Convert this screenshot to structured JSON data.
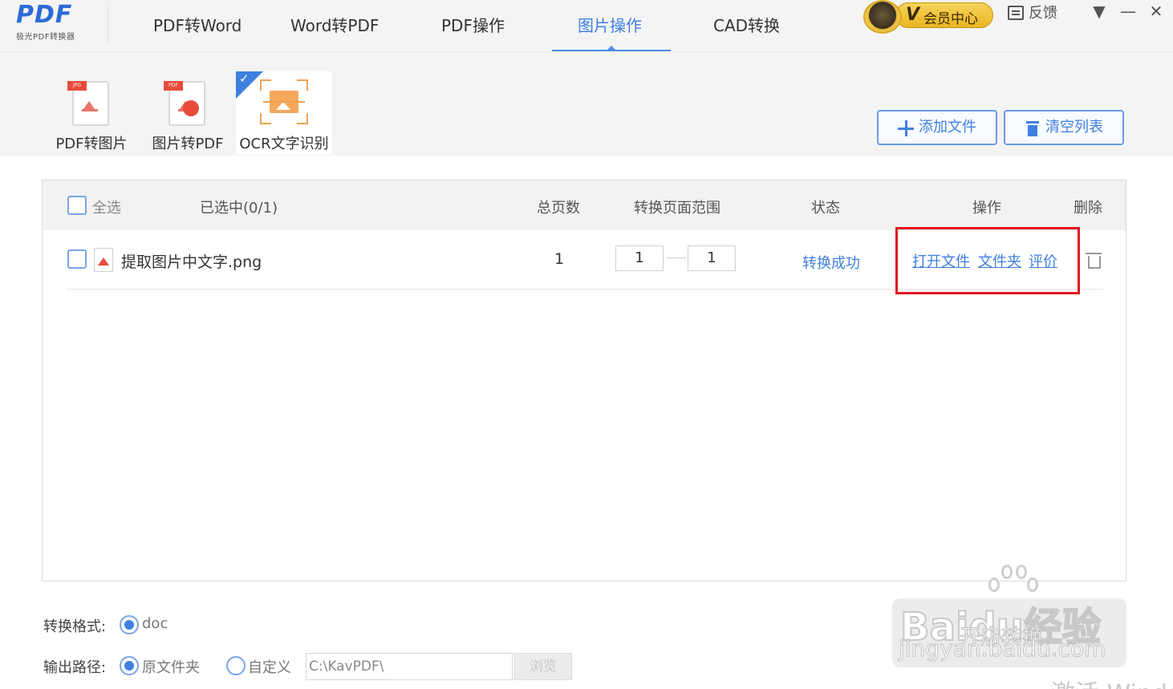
{
  "app": {
    "logo_text": "PDF",
    "logo_subtitle": "极光PDF转换器"
  },
  "nav": {
    "tabs": [
      {
        "label": "PDF转Word"
      },
      {
        "label": "Word转PDF"
      },
      {
        "label": "PDF操作"
      },
      {
        "label": "图片操作",
        "active": true
      },
      {
        "label": "CAD转换"
      }
    ]
  },
  "header": {
    "vip_v": "V",
    "vip_label": "会员中心",
    "feedback_label": "反馈",
    "menu_glyph": "▼",
    "minimize_glyph": "—",
    "close_glyph": "✕"
  },
  "tools": [
    {
      "label": "PDF转图片",
      "icon": "pdf-to-image-icon",
      "tag": "JPG"
    },
    {
      "label": "图片转PDF",
      "icon": "image-to-pdf-icon",
      "tag": "PDF"
    },
    {
      "label": "OCR文字识别",
      "icon": "ocr-scan-icon",
      "selected": true
    }
  ],
  "actions": {
    "add_file": "添加文件",
    "clear_list": "清空列表"
  },
  "table": {
    "select_all": "全选",
    "selected_count": "已选中(0/1)",
    "columns": {
      "pages": "总页数",
      "range": "转换页面范围",
      "status": "状态",
      "operation": "操作",
      "delete": "删除"
    },
    "rows": [
      {
        "file_name": "提取图片中文字.png",
        "pages": "1",
        "range_from": "1",
        "range_to": "1",
        "status": "转换成功",
        "actions": [
          "打开文件",
          "文件夹",
          "评价"
        ]
      }
    ]
  },
  "options": {
    "format_label": "转换格式:",
    "format_value": "doc",
    "output_label": "输出路径:",
    "output_original": "原文件夹",
    "output_custom": "自定义",
    "output_path": "C:\\KavPDF\\",
    "browse": "浏览"
  },
  "watermark": {
    "brand": "Baidu经验",
    "sub": "开店转换",
    "url": "jingyan.baidu.com"
  },
  "os_overlay": {
    "activate_text": "激活 Windo"
  },
  "colors": {
    "accent": "#3f7fdf",
    "highlight_border": "#e0141e",
    "vip_gold": "#f2c94c"
  }
}
